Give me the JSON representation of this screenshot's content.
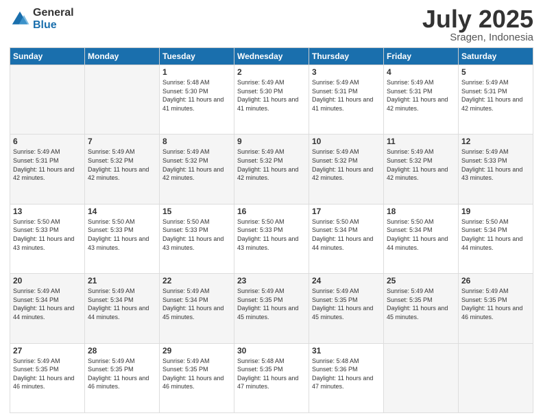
{
  "header": {
    "logo_general": "General",
    "logo_blue": "Blue",
    "title": "July 2025",
    "location": "Sragen, Indonesia"
  },
  "days_of_week": [
    "Sunday",
    "Monday",
    "Tuesday",
    "Wednesday",
    "Thursday",
    "Friday",
    "Saturday"
  ],
  "weeks": [
    [
      {
        "day": "",
        "sunrise": "",
        "sunset": "",
        "daylight": ""
      },
      {
        "day": "",
        "sunrise": "",
        "sunset": "",
        "daylight": ""
      },
      {
        "day": "1",
        "sunrise": "Sunrise: 5:48 AM",
        "sunset": "Sunset: 5:30 PM",
        "daylight": "Daylight: 11 hours and 41 minutes."
      },
      {
        "day": "2",
        "sunrise": "Sunrise: 5:49 AM",
        "sunset": "Sunset: 5:30 PM",
        "daylight": "Daylight: 11 hours and 41 minutes."
      },
      {
        "day": "3",
        "sunrise": "Sunrise: 5:49 AM",
        "sunset": "Sunset: 5:31 PM",
        "daylight": "Daylight: 11 hours and 41 minutes."
      },
      {
        "day": "4",
        "sunrise": "Sunrise: 5:49 AM",
        "sunset": "Sunset: 5:31 PM",
        "daylight": "Daylight: 11 hours and 42 minutes."
      },
      {
        "day": "5",
        "sunrise": "Sunrise: 5:49 AM",
        "sunset": "Sunset: 5:31 PM",
        "daylight": "Daylight: 11 hours and 42 minutes."
      }
    ],
    [
      {
        "day": "6",
        "sunrise": "Sunrise: 5:49 AM",
        "sunset": "Sunset: 5:31 PM",
        "daylight": "Daylight: 11 hours and 42 minutes."
      },
      {
        "day": "7",
        "sunrise": "Sunrise: 5:49 AM",
        "sunset": "Sunset: 5:32 PM",
        "daylight": "Daylight: 11 hours and 42 minutes."
      },
      {
        "day": "8",
        "sunrise": "Sunrise: 5:49 AM",
        "sunset": "Sunset: 5:32 PM",
        "daylight": "Daylight: 11 hours and 42 minutes."
      },
      {
        "day": "9",
        "sunrise": "Sunrise: 5:49 AM",
        "sunset": "Sunset: 5:32 PM",
        "daylight": "Daylight: 11 hours and 42 minutes."
      },
      {
        "day": "10",
        "sunrise": "Sunrise: 5:49 AM",
        "sunset": "Sunset: 5:32 PM",
        "daylight": "Daylight: 11 hours and 42 minutes."
      },
      {
        "day": "11",
        "sunrise": "Sunrise: 5:49 AM",
        "sunset": "Sunset: 5:32 PM",
        "daylight": "Daylight: 11 hours and 42 minutes."
      },
      {
        "day": "12",
        "sunrise": "Sunrise: 5:49 AM",
        "sunset": "Sunset: 5:33 PM",
        "daylight": "Daylight: 11 hours and 43 minutes."
      }
    ],
    [
      {
        "day": "13",
        "sunrise": "Sunrise: 5:50 AM",
        "sunset": "Sunset: 5:33 PM",
        "daylight": "Daylight: 11 hours and 43 minutes."
      },
      {
        "day": "14",
        "sunrise": "Sunrise: 5:50 AM",
        "sunset": "Sunset: 5:33 PM",
        "daylight": "Daylight: 11 hours and 43 minutes."
      },
      {
        "day": "15",
        "sunrise": "Sunrise: 5:50 AM",
        "sunset": "Sunset: 5:33 PM",
        "daylight": "Daylight: 11 hours and 43 minutes."
      },
      {
        "day": "16",
        "sunrise": "Sunrise: 5:50 AM",
        "sunset": "Sunset: 5:33 PM",
        "daylight": "Daylight: 11 hours and 43 minutes."
      },
      {
        "day": "17",
        "sunrise": "Sunrise: 5:50 AM",
        "sunset": "Sunset: 5:34 PM",
        "daylight": "Daylight: 11 hours and 44 minutes."
      },
      {
        "day": "18",
        "sunrise": "Sunrise: 5:50 AM",
        "sunset": "Sunset: 5:34 PM",
        "daylight": "Daylight: 11 hours and 44 minutes."
      },
      {
        "day": "19",
        "sunrise": "Sunrise: 5:50 AM",
        "sunset": "Sunset: 5:34 PM",
        "daylight": "Daylight: 11 hours and 44 minutes."
      }
    ],
    [
      {
        "day": "20",
        "sunrise": "Sunrise: 5:49 AM",
        "sunset": "Sunset: 5:34 PM",
        "daylight": "Daylight: 11 hours and 44 minutes."
      },
      {
        "day": "21",
        "sunrise": "Sunrise: 5:49 AM",
        "sunset": "Sunset: 5:34 PM",
        "daylight": "Daylight: 11 hours and 44 minutes."
      },
      {
        "day": "22",
        "sunrise": "Sunrise: 5:49 AM",
        "sunset": "Sunset: 5:34 PM",
        "daylight": "Daylight: 11 hours and 45 minutes."
      },
      {
        "day": "23",
        "sunrise": "Sunrise: 5:49 AM",
        "sunset": "Sunset: 5:35 PM",
        "daylight": "Daylight: 11 hours and 45 minutes."
      },
      {
        "day": "24",
        "sunrise": "Sunrise: 5:49 AM",
        "sunset": "Sunset: 5:35 PM",
        "daylight": "Daylight: 11 hours and 45 minutes."
      },
      {
        "day": "25",
        "sunrise": "Sunrise: 5:49 AM",
        "sunset": "Sunset: 5:35 PM",
        "daylight": "Daylight: 11 hours and 45 minutes."
      },
      {
        "day": "26",
        "sunrise": "Sunrise: 5:49 AM",
        "sunset": "Sunset: 5:35 PM",
        "daylight": "Daylight: 11 hours and 46 minutes."
      }
    ],
    [
      {
        "day": "27",
        "sunrise": "Sunrise: 5:49 AM",
        "sunset": "Sunset: 5:35 PM",
        "daylight": "Daylight: 11 hours and 46 minutes."
      },
      {
        "day": "28",
        "sunrise": "Sunrise: 5:49 AM",
        "sunset": "Sunset: 5:35 PM",
        "daylight": "Daylight: 11 hours and 46 minutes."
      },
      {
        "day": "29",
        "sunrise": "Sunrise: 5:49 AM",
        "sunset": "Sunset: 5:35 PM",
        "daylight": "Daylight: 11 hours and 46 minutes."
      },
      {
        "day": "30",
        "sunrise": "Sunrise: 5:48 AM",
        "sunset": "Sunset: 5:35 PM",
        "daylight": "Daylight: 11 hours and 47 minutes."
      },
      {
        "day": "31",
        "sunrise": "Sunrise: 5:48 AM",
        "sunset": "Sunset: 5:36 PM",
        "daylight": "Daylight: 11 hours and 47 minutes."
      },
      {
        "day": "",
        "sunrise": "",
        "sunset": "",
        "daylight": ""
      },
      {
        "day": "",
        "sunrise": "",
        "sunset": "",
        "daylight": ""
      }
    ]
  ]
}
